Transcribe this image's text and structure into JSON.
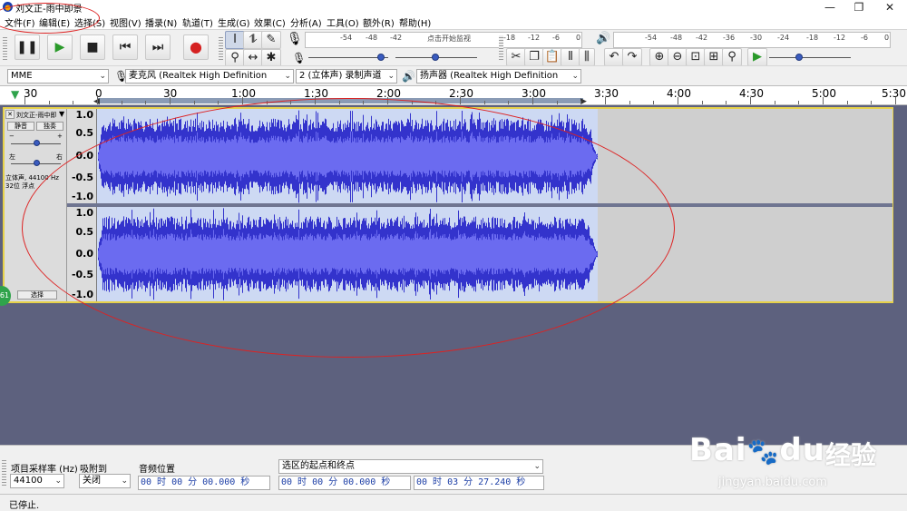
{
  "window": {
    "title": "刘文正-雨中即景",
    "controls": {
      "minimize": "—",
      "maximize": "❐",
      "close": "✕"
    }
  },
  "menu": [
    "文件(F)",
    "编辑(E)",
    "选择(S)",
    "视图(V)",
    "播录(N)",
    "轨道(T)",
    "生成(G)",
    "效果(C)",
    "分析(A)",
    "工具(O)",
    "额外(R)",
    "帮助(H)"
  ],
  "transport": {
    "pause": "pause-icon",
    "play": "play-icon",
    "stop": "stop-icon",
    "skip_start": "skip-start-icon",
    "skip_end": "skip-end-icon",
    "record": "record-icon"
  },
  "meters": {
    "record_ticks": [
      "-54",
      "-48",
      "-42",
      "-18",
      "-12",
      "-6",
      "0"
    ],
    "record_hint": "点击开始监视",
    "play_ticks": [
      "-54",
      "-48",
      "-42",
      "-36",
      "-30",
      "-24",
      "-18",
      "-12",
      "-6",
      "0"
    ],
    "record_volume": 0.95,
    "play_volume": 0.35
  },
  "device": {
    "host": "MME",
    "input_device": "麦克风 (Realtek High Definition",
    "channels": "2 (立体声) 录制声道",
    "output_device": "扬声器 (Realtek High Definition"
  },
  "ruler": {
    "labels": [
      "30",
      "0",
      "30",
      "1:00",
      "1:30",
      "2:00",
      "2:30",
      "3:00",
      "3:30",
      "4:00",
      "4:30",
      "5:00",
      "5:30"
    ],
    "selection_start": "0",
    "selection_end": "3:27"
  },
  "track": {
    "name": "刘文正-雨中即",
    "mute": "静音",
    "solo": "独奏",
    "gain_minus": "−",
    "gain_plus": "+",
    "pan_left": "左",
    "pan_right": "右",
    "info_line1": "立体声, 44100 Hz",
    "info_line2": "32位 浮点",
    "select_button": "选择",
    "scale": [
      "1.0",
      "0.5",
      "0.0",
      "-0.5",
      "-1.0"
    ],
    "duration_seconds": 207.24,
    "badge": "61"
  },
  "bottom": {
    "rate_label": "项目采样率 (Hz)",
    "rate_value": "44100",
    "snap_label": "吸附到",
    "snap_value": "关闭",
    "position_label": "音频位置",
    "position_value": "00 时 00 分 00.000 秒",
    "selection_mode": "选区的起点和终点",
    "selection_start": "00 时 00 分 00.000 秒",
    "selection_end": "00 时 03 分 27.240 秒"
  },
  "status": "已停止.",
  "watermark": {
    "brand": "Bai",
    "brand2": "du",
    "cn": "经验",
    "url": "jingyan.baidu.com"
  }
}
